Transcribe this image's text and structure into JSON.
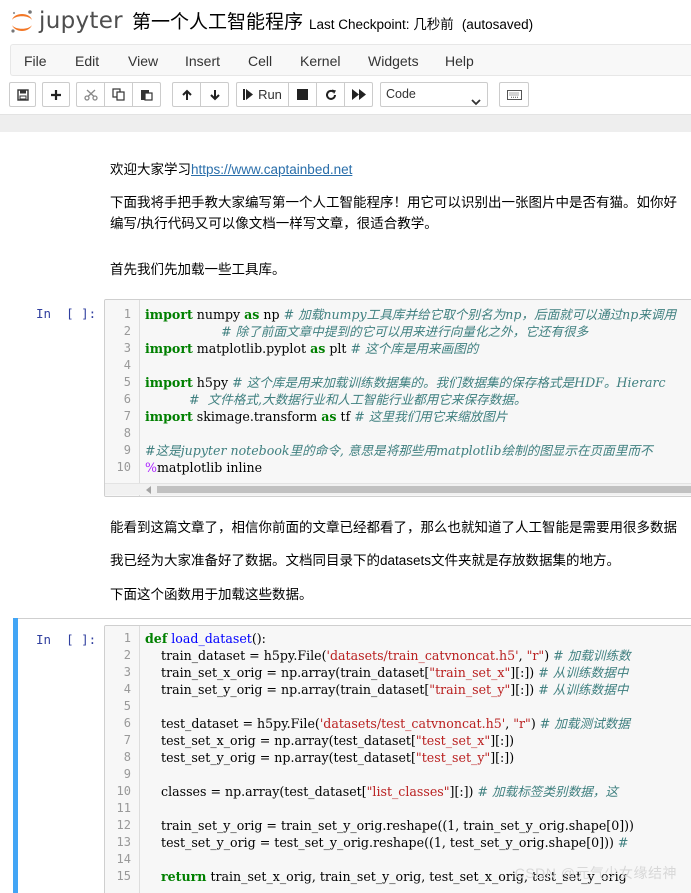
{
  "header": {
    "logo_text": "jupyter",
    "notebook_title": "第一个人工智能程序",
    "checkpoint": "Last Checkpoint: 几秒前",
    "autosaved": "(autosaved)"
  },
  "menu": [
    "File",
    "Edit",
    "View",
    "Insert",
    "Cell",
    "Kernel",
    "Widgets",
    "Help"
  ],
  "toolbar": {
    "run_label": "Run",
    "cell_type": "Code",
    "icons": [
      "save-icon",
      "plus-icon",
      "cut-icon",
      "copy-icon",
      "paste-icon",
      "arrow-up-icon",
      "arrow-down-icon",
      "step-forward-icon",
      "stop-icon",
      "restart-icon",
      "fast-forward-icon",
      "keyboard-icon"
    ]
  },
  "markdown": {
    "welcome_prefix": "欢迎大家学习",
    "welcome_link": "https://www.captainbed.net",
    "intro_line1": "下面我将手把手教大家编写第一个人工智能程序！用它可以识别出一张图片中是否有猫。如你好",
    "intro_line2": "编写/执行代码又可以像文档一样写文章，很适合教学。",
    "load_libs": "首先我们先加载一些工具库。",
    "para_article": "能看到这篇文章了，相信你前面的文章已经都看了，那么也就知道了人工智能是需要用很多数据",
    "para_data": "我已经为大家准备好了数据。文档同目录下的datasets文件夹就是存放数据集的地方。",
    "para_func": "下面这个函数用于加载这些数据。"
  },
  "cell1": {
    "prompt": "In  [ ]:",
    "lines": [
      {
        "n": "1",
        "t": [
          [
            "kw",
            "import"
          ],
          [
            "nm",
            " numpy "
          ],
          [
            "kw",
            "as"
          ],
          [
            "nm",
            " np "
          ],
          [
            "cm",
            "# 加载numpy工具库并给它取个别名为np，后面就可以通过np来调用"
          ]
        ]
      },
      {
        "n": "2",
        "t": [
          [
            "nm",
            "                   "
          ],
          [
            "cm",
            "# 除了前面文章中提到的它可以用来进行向量化之外，它还有很多"
          ]
        ]
      },
      {
        "n": "3",
        "t": [
          [
            "kw",
            "import"
          ],
          [
            "nm",
            " matplotlib.pyplot "
          ],
          [
            "kw",
            "as"
          ],
          [
            "nm",
            " plt "
          ],
          [
            "cm",
            "# 这个库是用来画图的"
          ]
        ]
      },
      {
        "n": "4",
        "t": []
      },
      {
        "n": "5",
        "t": [
          [
            "kw",
            "import"
          ],
          [
            "nm",
            " h5py "
          ],
          [
            "cm",
            "# 这个库是用来加载训练数据集的。我们数据集的保存格式是HDF。Hierarc"
          ]
        ]
      },
      {
        "n": "6",
        "t": [
          [
            "nm",
            "           "
          ],
          [
            "cm",
            "#  文件格式,大数据行业和人工智能行业都用它来保存数据。"
          ]
        ]
      },
      {
        "n": "7",
        "t": [
          [
            "kw",
            "import"
          ],
          [
            "nm",
            " skimage.transform "
          ],
          [
            "kw",
            "as"
          ],
          [
            "nm",
            " tf "
          ],
          [
            "cm",
            "# 这里我们用它来缩放图片"
          ]
        ]
      },
      {
        "n": "8",
        "t": []
      },
      {
        "n": "9",
        "t": [
          [
            "cm",
            "#这是jupyter notebook里的命令, 意思是将那些用matplotlib绘制的图显示在页面里而不"
          ]
        ]
      },
      {
        "n": "10",
        "t": [
          [
            "mg",
            "%"
          ],
          [
            "nm",
            "matplotlib inline"
          ]
        ]
      }
    ]
  },
  "cell2": {
    "prompt": "In  [ ]:",
    "lines": [
      {
        "n": "1",
        "t": [
          [
            "kw",
            "def"
          ],
          [
            "nm",
            " "
          ],
          [
            "fn",
            "load_dataset"
          ],
          [
            "nm",
            "():"
          ]
        ]
      },
      {
        "n": "2",
        "t": [
          [
            "nm",
            "    train_dataset = h5py.File("
          ],
          [
            "st",
            "'datasets/train_catvnoncat.h5'"
          ],
          [
            "nm",
            ", "
          ],
          [
            "st",
            "\"r\""
          ],
          [
            "nm",
            ") "
          ],
          [
            "cm",
            "# 加载训练数"
          ]
        ]
      },
      {
        "n": "3",
        "t": [
          [
            "nm",
            "    train_set_x_orig = np.array(train_dataset["
          ],
          [
            "st",
            "\"train_set_x\""
          ],
          [
            "nm",
            "][:]) "
          ],
          [
            "cm",
            "# 从训练数据中"
          ]
        ]
      },
      {
        "n": "4",
        "t": [
          [
            "nm",
            "    train_set_y_orig = np.array(train_dataset["
          ],
          [
            "st",
            "\"train_set_y\""
          ],
          [
            "nm",
            "][:]) "
          ],
          [
            "cm",
            "# 从训练数据中"
          ]
        ]
      },
      {
        "n": "5",
        "t": []
      },
      {
        "n": "6",
        "t": [
          [
            "nm",
            "    test_dataset = h5py.File("
          ],
          [
            "st",
            "'datasets/test_catvnoncat.h5'"
          ],
          [
            "nm",
            ", "
          ],
          [
            "st",
            "\"r\""
          ],
          [
            "nm",
            ") "
          ],
          [
            "cm",
            "# 加载测试数据"
          ]
        ]
      },
      {
        "n": "7",
        "t": [
          [
            "nm",
            "    test_set_x_orig = np.array(test_dataset["
          ],
          [
            "st",
            "\"test_set_x\""
          ],
          [
            "nm",
            "][:])"
          ]
        ]
      },
      {
        "n": "8",
        "t": [
          [
            "nm",
            "    test_set_y_orig = np.array(test_dataset["
          ],
          [
            "st",
            "\"test_set_y\""
          ],
          [
            "nm",
            "][:])"
          ]
        ]
      },
      {
        "n": "9",
        "t": []
      },
      {
        "n": "10",
        "t": [
          [
            "nm",
            "    classes = np.array(test_dataset["
          ],
          [
            "st",
            "\"list_classes\""
          ],
          [
            "nm",
            "][:]) "
          ],
          [
            "cm",
            "# 加载标签类别数据，这"
          ]
        ]
      },
      {
        "n": "11",
        "t": []
      },
      {
        "n": "12",
        "t": [
          [
            "nm",
            "    train_set_y_orig = train_set_y_orig.reshape((1, train_set_y_orig.shape[0]))"
          ]
        ]
      },
      {
        "n": "13",
        "t": [
          [
            "nm",
            "    test_set_y_orig = test_set_y_orig.reshape((1, test_set_y_orig.shape[0])) "
          ],
          [
            "cm",
            "#"
          ]
        ]
      },
      {
        "n": "14",
        "t": []
      },
      {
        "n": "15",
        "t": [
          [
            "nm",
            "    "
          ],
          [
            "kw",
            "return"
          ],
          [
            "nm",
            " train_set_x_orig, train_set_y_orig, test_set_x_orig, test_set_y_orig"
          ]
        ]
      }
    ]
  },
  "watermark": "CSDN @元气少女缘结神"
}
